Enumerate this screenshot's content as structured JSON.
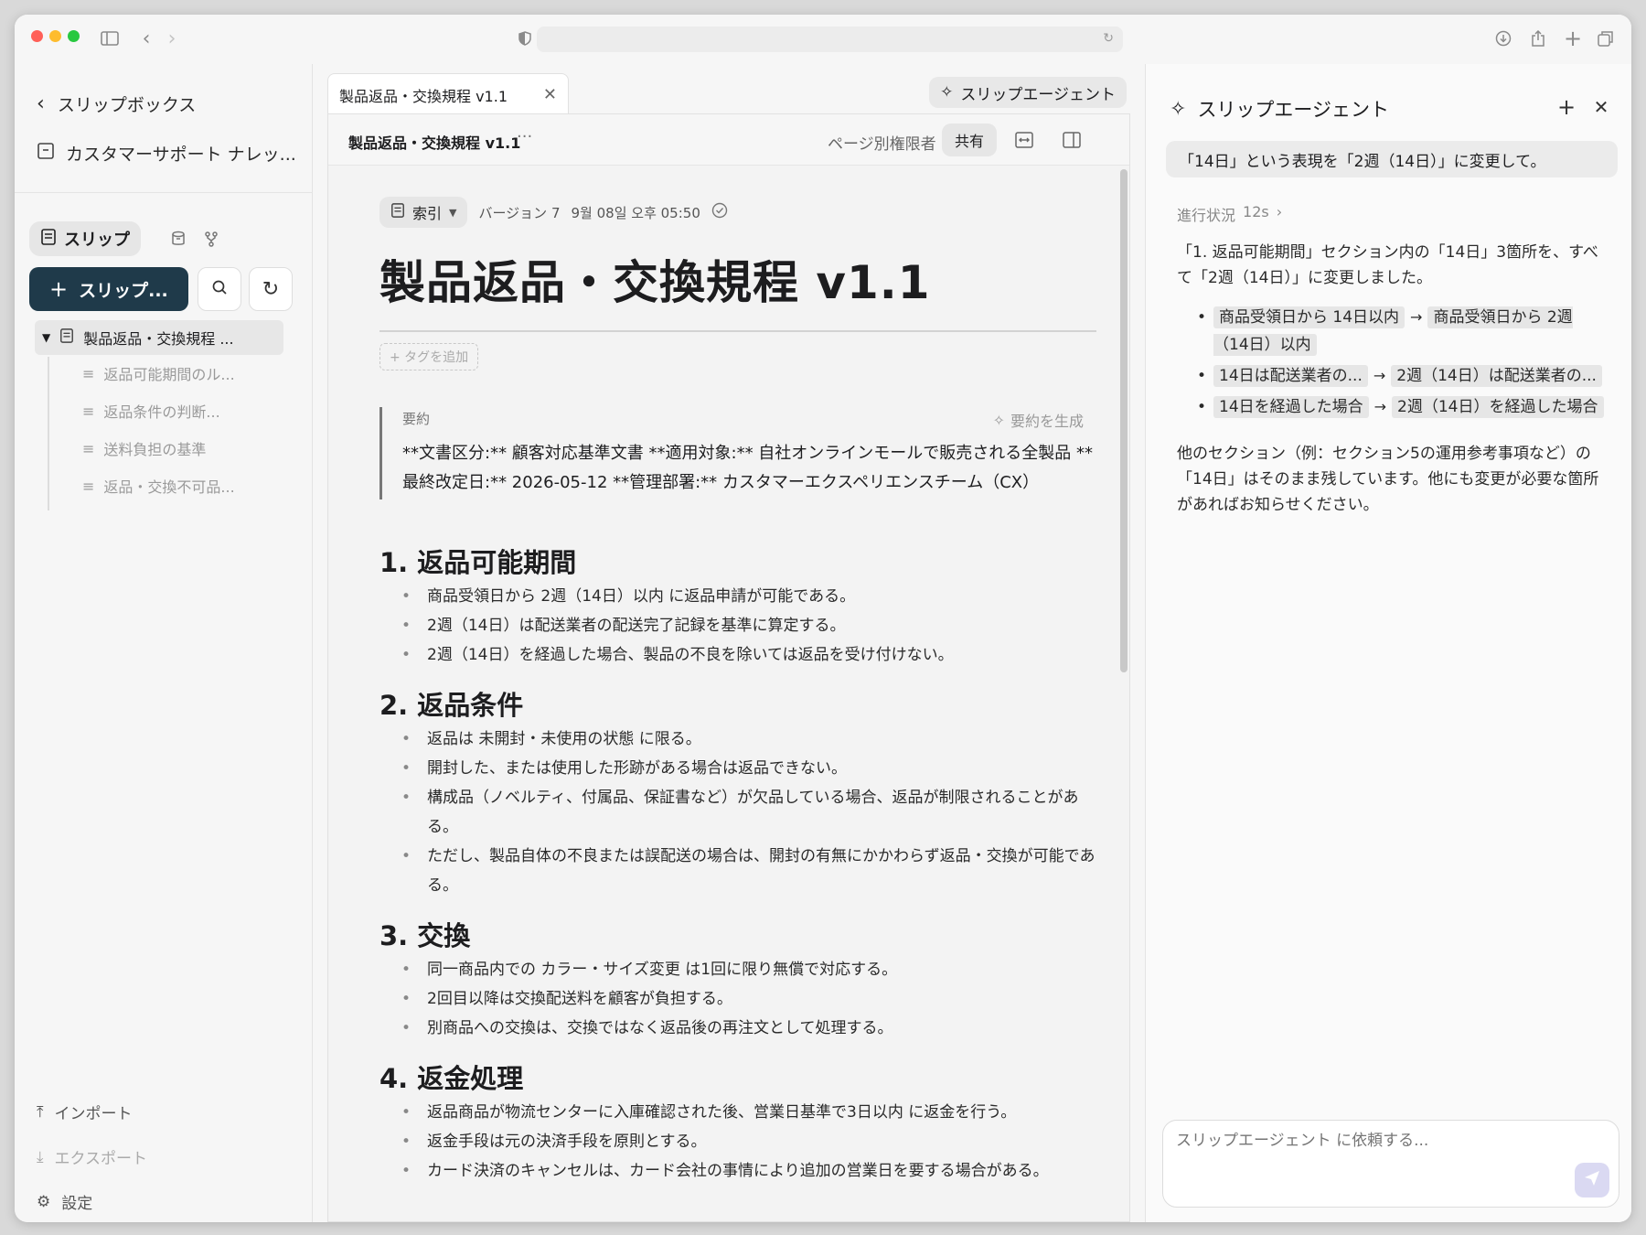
{
  "sidebar": {
    "back_label": "スリップボックス",
    "workspace": "カスタマーサポート ナレッ...",
    "segment_label": "スリップ",
    "new_button": "スリップ...",
    "tree_root": "製品返品・交換規程 ...",
    "tree_items": [
      {
        "label": "返品可能期間のル..."
      },
      {
        "label": "返品条件の判断..."
      },
      {
        "label": "送料負担の基準"
      },
      {
        "label": "返品・交換不可品..."
      }
    ],
    "import_label": "インポート",
    "export_label": "エクスポート",
    "settings_label": "設定"
  },
  "center": {
    "tab_title": "製品返品・交換規程 v1.1",
    "agent_button": "スリップエージェント",
    "doc_header_title": "製品返品・交換規程 v1.1",
    "more": "···",
    "permission": "ページ別権限者",
    "share": "共有"
  },
  "doc": {
    "index_label": "索引",
    "version": "バージョン 7",
    "date": "9월 08일 오후 05:50",
    "title": "製品返品・交換規程 v1.1",
    "add_tag": "+ タグを追加",
    "summary_label": "要約",
    "generate_summary": "要約を生成",
    "summary_text": "**文書区分:** 顧客対応基準文書 **適用対象:** 自社オンラインモールで販売される全製品 **最終改定日:** 2026-05-12 **管理部署:** カスタマーエクスペリエンスチーム（CX）",
    "sections": [
      {
        "heading": "1. 返品可能期間",
        "items": [
          "商品受領日から 2週（14日）以内 に返品申請が可能である。",
          "2週（14日）は配送業者の配送完了記録を基準に算定する。",
          "2週（14日）を経過した場合、製品の不良を除いては返品を受け付けない。"
        ]
      },
      {
        "heading": "2. 返品条件",
        "items": [
          "返品は 未開封・未使用の状態 に限る。",
          "開封した、または使用した形跡がある場合は返品できない。",
          "構成品（ノベルティ、付属品、保証書など）が欠品している場合、返品が制限されることがある。",
          "ただし、製品自体の不良または誤配送の場合は、開封の有無にかかわらず返品・交換が可能である。"
        ]
      },
      {
        "heading": "3. 交換",
        "items": [
          "同一商品内での カラー・サイズ変更 は1回に限り無償で対応する。",
          "2回目以降は交換配送料を顧客が負担する。",
          "別商品への交換は、交換ではなく返品後の再注文として処理する。"
        ]
      },
      {
        "heading": "4. 返金処理",
        "items": [
          "返品商品が物流センターに入庫確認された後、営業日基準で3日以内 に返金を行う。",
          "返金手段は元の決済手段を原則とする。",
          "カード決済のキャンセルは、カード会社の事情により追加の営業日を要する場合がある。"
        ]
      }
    ]
  },
  "agent": {
    "title": "スリップエージェント",
    "user_message": "「14日」という表現を「2週（14日）」に変更して。",
    "progress_label": "進行状況",
    "progress_time": "12s",
    "reply_intro": "「1. 返品可能期間」セクション内の「14日」3箇所を、すべて「2週（14日）」に変更しました。",
    "changes": [
      {
        "from": "商品受領日から 14日以内",
        "to": "商品受領日から 2週（14日）以内"
      },
      {
        "from": "14日は配送業者の...",
        "to": "2週（14日）は配送業者の..."
      },
      {
        "from": "14日を経過した場合",
        "to": "2週（14日）を経過した場合"
      }
    ],
    "reply_outro": "他のセクション（例：セクション5の運用参考事項など）の「14日」はそのまま残しています。他にも変更が必要な箇所があればお知らせください。",
    "input_placeholder": "スリップエージェント に依頼する..."
  }
}
